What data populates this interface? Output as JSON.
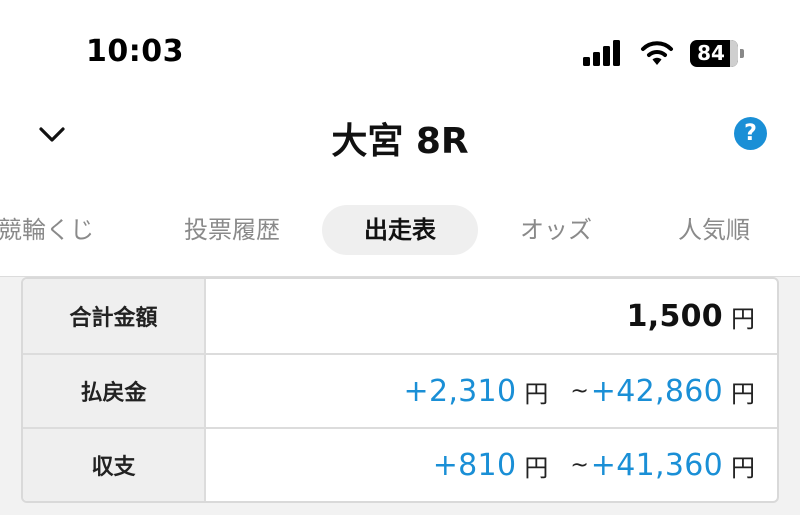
{
  "status_bar": {
    "time": "10:03",
    "battery_level": "84",
    "icons": [
      "signal-icon",
      "wifi-icon",
      "battery-icon"
    ]
  },
  "header": {
    "title": "大宮 8R",
    "back_icon": "chevron-down-icon",
    "help_label": "?"
  },
  "tabs": [
    {
      "label": "競輪くじ",
      "active": false
    },
    {
      "label": "投票履歴",
      "active": false
    },
    {
      "label": "出走表",
      "active": true
    },
    {
      "label": "オッズ",
      "active": false
    },
    {
      "label": "人気順",
      "active": false
    }
  ],
  "summary": {
    "total": {
      "label": "合計金額",
      "value": "1,500",
      "unit": "円"
    },
    "payout": {
      "label": "払戻金",
      "min": "+2,310",
      "max": "+42,860",
      "unit": "円",
      "range_sep": "~"
    },
    "balance": {
      "label": "収支",
      "min": "+810",
      "max": "+41,360",
      "unit": "円",
      "range_sep": "~"
    }
  },
  "colors": {
    "accent": "#1a8fd6",
    "tab_active_bg": "#efefef",
    "panel_bg": "#f2f2f2"
  }
}
